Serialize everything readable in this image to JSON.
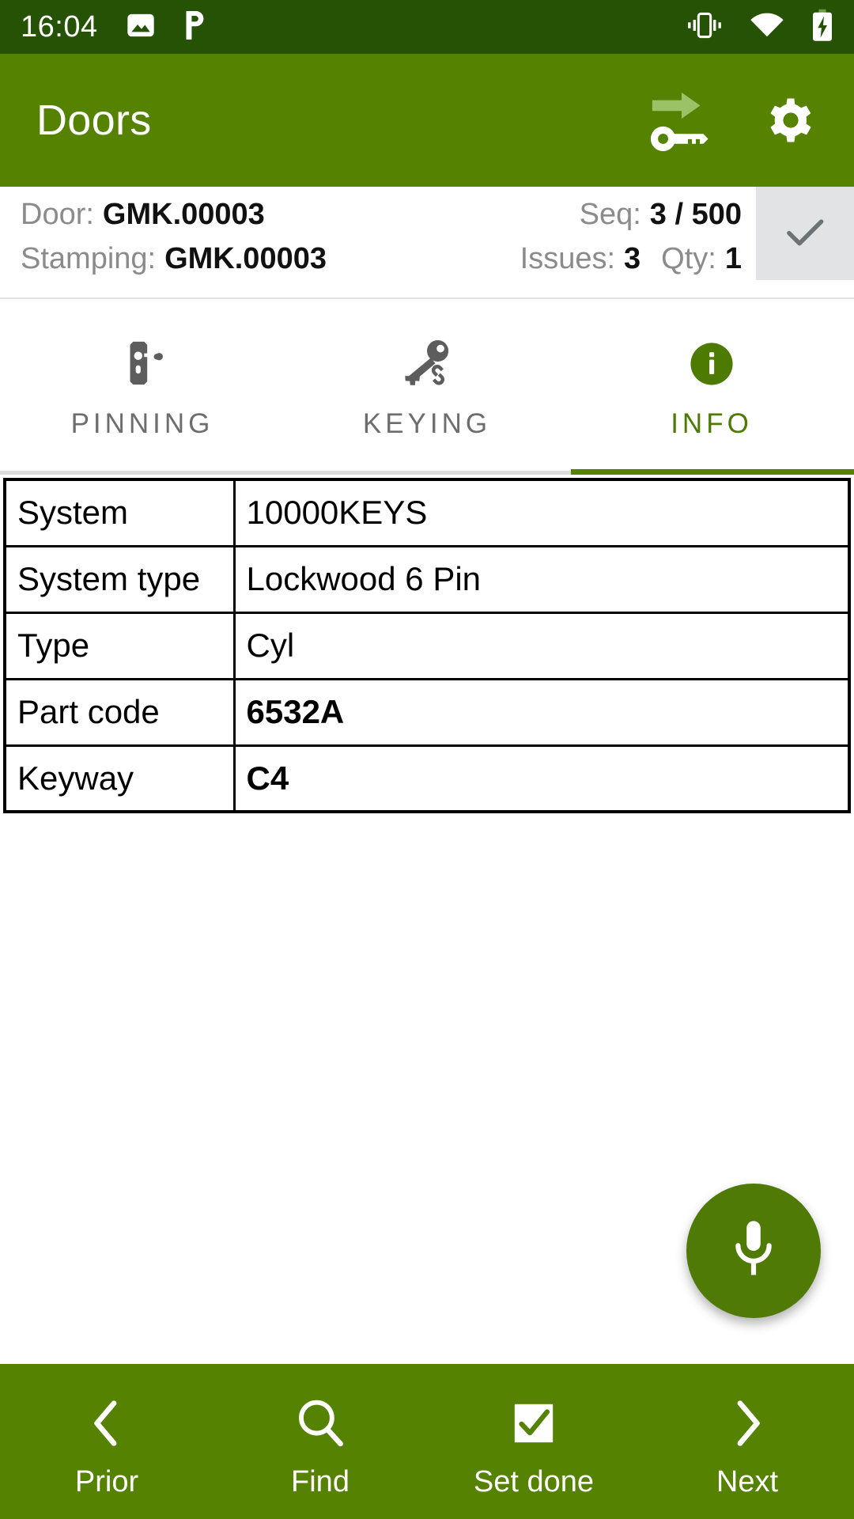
{
  "status_bar": {
    "time": "16:04",
    "left_icons": [
      "image-icon",
      "pocket-p-icon"
    ],
    "right_icons": [
      "vibrate-icon",
      "wifi-icon",
      "battery-charging-icon"
    ],
    "background_color": "#265206",
    "foreground_color": "#ffffff"
  },
  "app_bar": {
    "title": "Doors",
    "background_color": "#558200",
    "actions": [
      {
        "name": "key-transfer-icon"
      },
      {
        "name": "gear-icon"
      }
    ]
  },
  "door_info": {
    "door_label": "Door:",
    "door_value": "GMK.00003",
    "stamping_label": "Stamping:",
    "stamping_value": "GMK.00003",
    "seq_label": "Seq:",
    "seq_value": "3 / 500",
    "issues_label": "Issues:",
    "issues_value": "3",
    "qty_label": "Qty:",
    "qty_value": "1",
    "done_icon": "check-icon"
  },
  "tabs": {
    "accent_color": "#558200",
    "active_index": 2,
    "items": [
      {
        "label": "PINNING",
        "icon": "door-handle-lock-icon",
        "active": false
      },
      {
        "label": "KEYING",
        "icon": "key-link-icon",
        "active": false
      },
      {
        "label": "INFO",
        "icon": "info-circle-icon",
        "active": true
      }
    ]
  },
  "info_table": {
    "rows": [
      {
        "key": "System",
        "value": "10000KEYS",
        "bold": false
      },
      {
        "key": "System type",
        "value": "Lockwood 6 Pin",
        "bold": false
      },
      {
        "key": "Type",
        "value": "Cyl",
        "bold": false
      },
      {
        "key": "Part code",
        "value": "6532A",
        "bold": true
      },
      {
        "key": "Keyway",
        "value": "C4",
        "bold": true
      }
    ]
  },
  "fab": {
    "icon": "microphone-icon",
    "background_color": "#4f7a05"
  },
  "bottom_nav": {
    "background_color": "#558200",
    "items": [
      {
        "label": "Prior",
        "icon": "chevron-left-icon"
      },
      {
        "label": "Find",
        "icon": "search-icon"
      },
      {
        "label": "Set done",
        "icon": "checkbox-checked-icon"
      },
      {
        "label": "Next",
        "icon": "chevron-right-icon"
      }
    ]
  }
}
